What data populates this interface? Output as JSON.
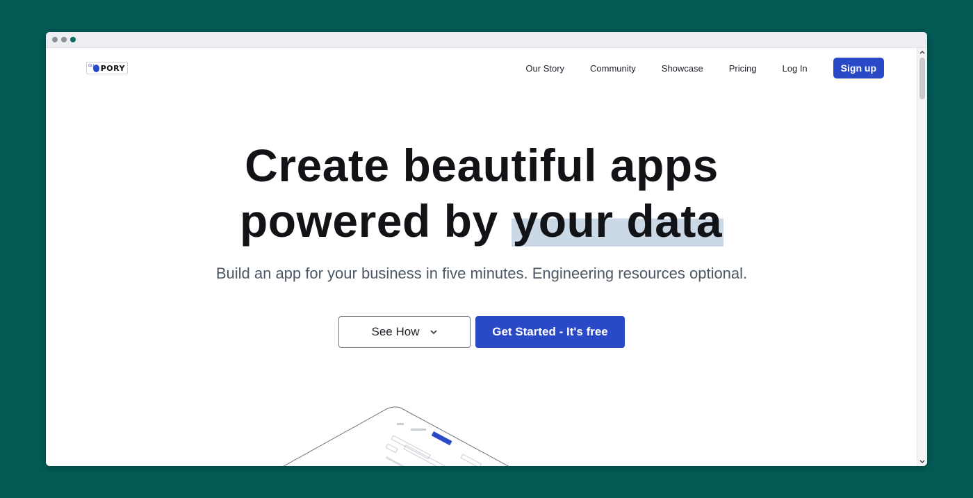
{
  "nav": {
    "logo_text": "PORY",
    "logo_small": "GLI",
    "links": [
      "Our Story",
      "Community",
      "Showcase",
      "Pricing",
      "Log In"
    ],
    "signup_label": "Sign up"
  },
  "hero": {
    "title_line1": "Create beautiful apps",
    "title_line2_prefix": "powered by ",
    "title_line2_highlight": "your data",
    "subtitle": "Build an app for your business in five minutes. Engineering resources optional."
  },
  "cta": {
    "see_how_label": "See How",
    "get_started_label": "Get Started - It's free"
  },
  "colors": {
    "background": "#045a55",
    "accent": "#2a49c6",
    "highlight": "#cbd8e6"
  },
  "icons": {
    "dropdown": "chevron-down-icon",
    "scroll_up": "chevron-up-icon",
    "scroll_down": "chevron-down-icon"
  }
}
